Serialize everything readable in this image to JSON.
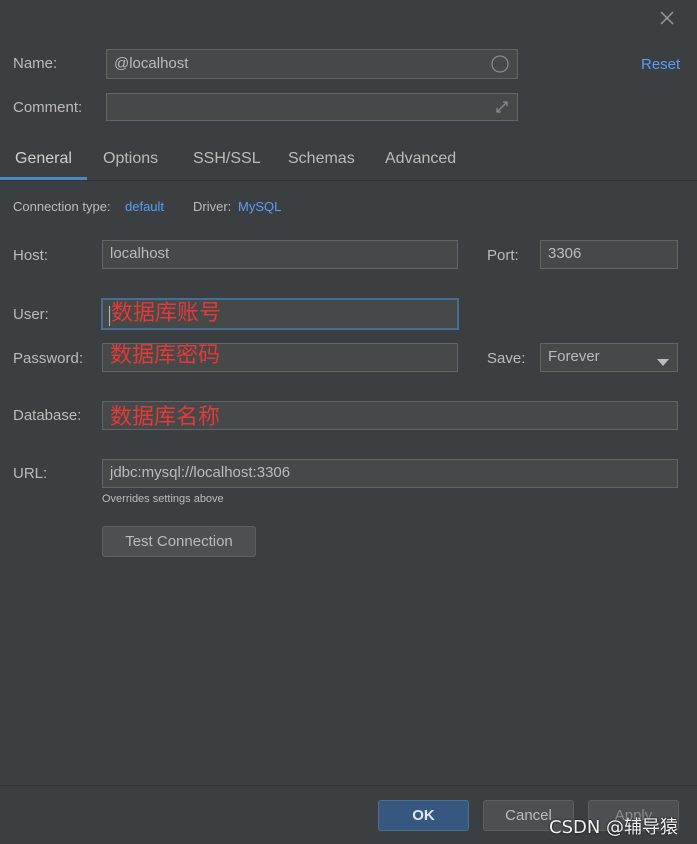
{
  "header": {
    "name_label": "Name:",
    "name_value": "@localhost",
    "comment_label": "Comment:",
    "comment_value": "",
    "reset_label": "Reset"
  },
  "tabs": [
    {
      "label": "General",
      "active": true
    },
    {
      "label": "Options"
    },
    {
      "label": "SSH/SSL"
    },
    {
      "label": "Schemas"
    },
    {
      "label": "Advanced"
    }
  ],
  "info": {
    "connection_type_label": "Connection type:",
    "connection_type_value": "default",
    "driver_label": "Driver:",
    "driver_value": "MySQL"
  },
  "form": {
    "host_label": "Host:",
    "host_value": "localhost",
    "port_label": "Port:",
    "port_value": "3306",
    "user_label": "User:",
    "user_annotation": "数据库账号",
    "password_label": "Password:",
    "password_annotation": "数据库密码",
    "save_label": "Save:",
    "save_value": "Forever",
    "database_label": "Database:",
    "database_annotation": "数据库名称",
    "url_label": "URL:",
    "url_value": "jdbc:mysql://localhost:3306",
    "url_hint": "Overrides settings above",
    "test_connection_label": "Test Connection"
  },
  "footer": {
    "ok_label": "OK",
    "cancel_label": "Cancel",
    "apply_label": "Apply"
  },
  "watermark": "CSDN @辅导猿",
  "colors": {
    "background": "#3c3f41",
    "link": "#589df6",
    "annotation": "#e53935",
    "primary_button": "#365880",
    "tab_underline": "#4a88c7"
  }
}
